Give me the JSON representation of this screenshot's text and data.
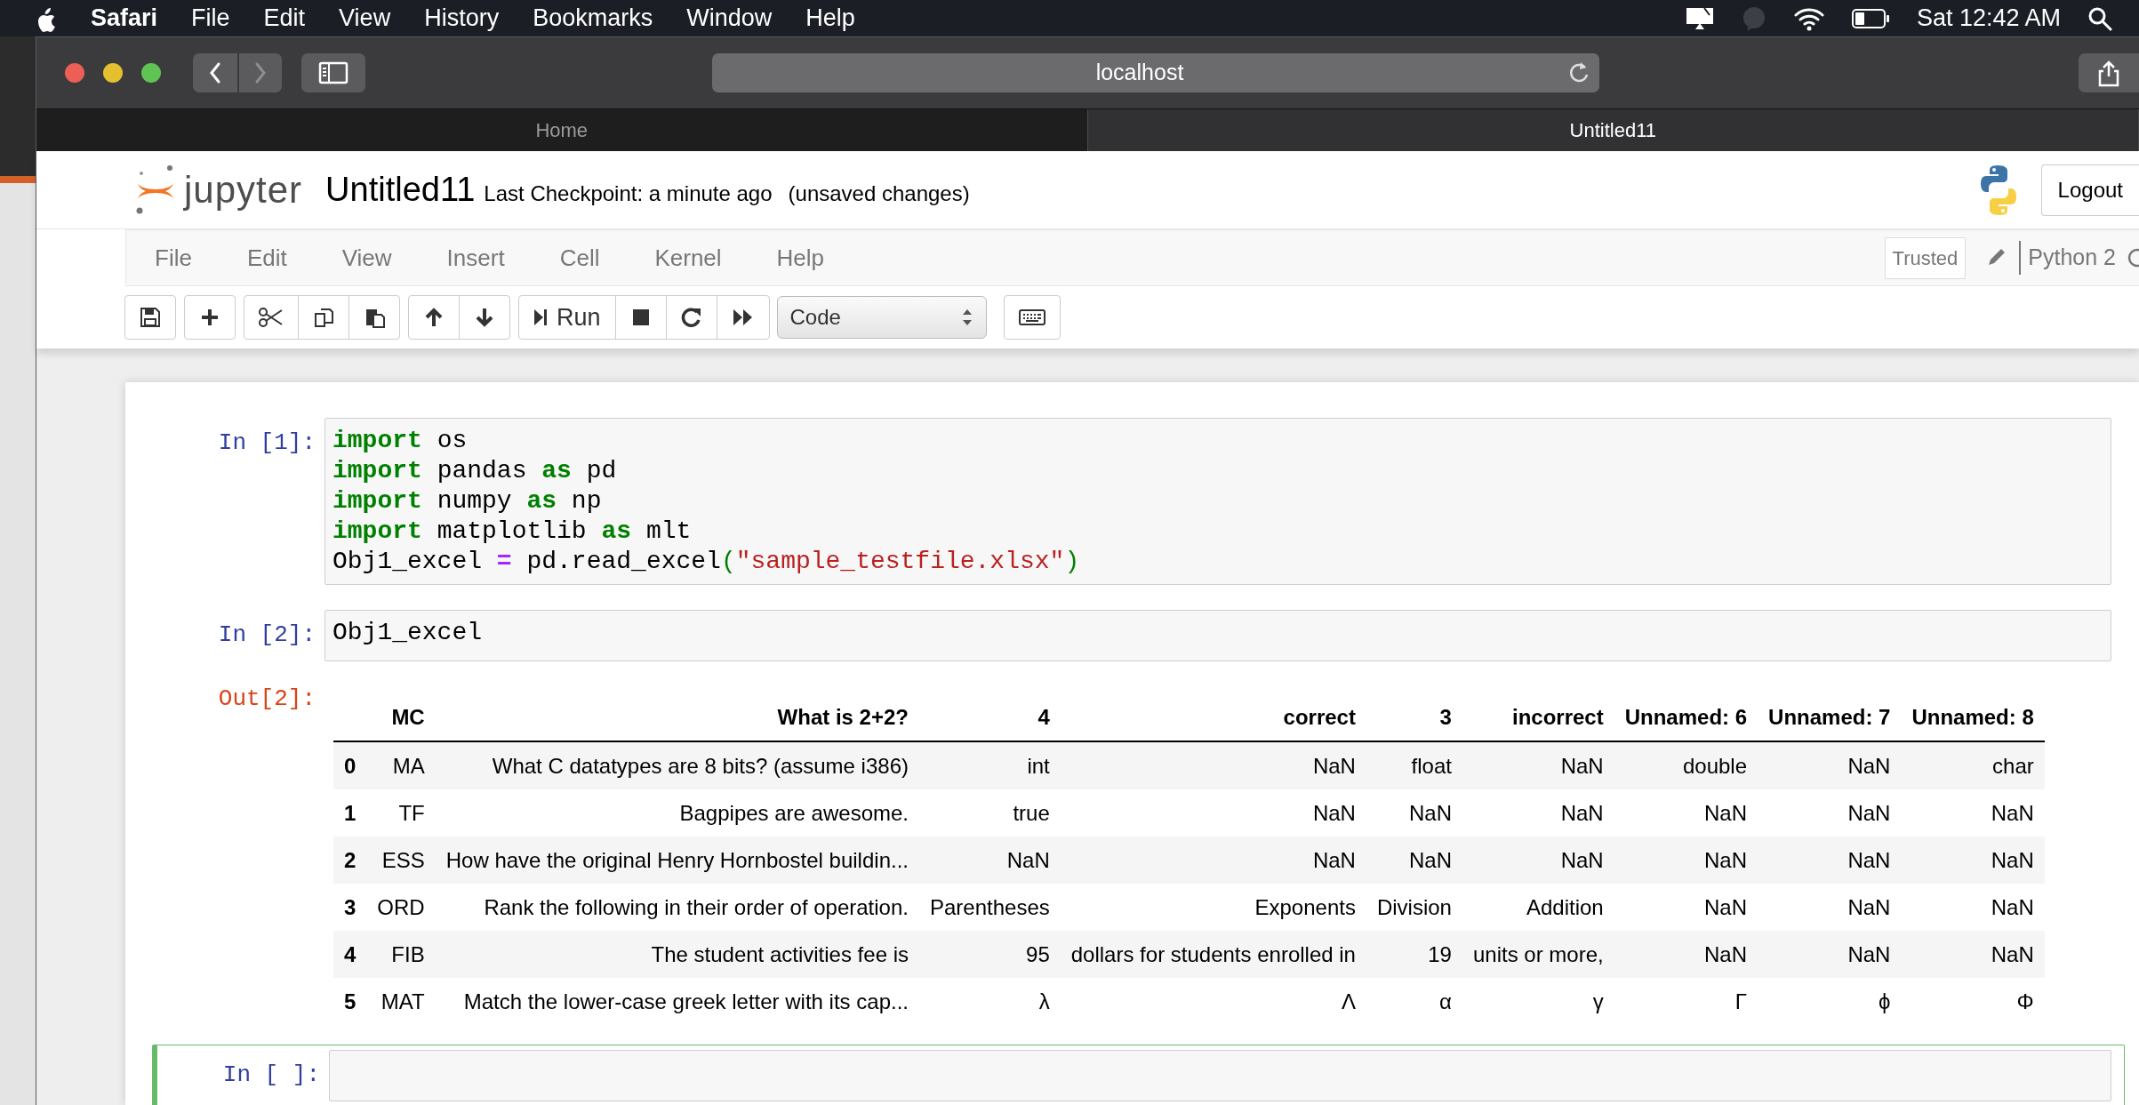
{
  "system_menu_bar": {
    "app": "Safari",
    "menus": [
      "File",
      "Edit",
      "View",
      "History",
      "Bookmarks",
      "Window",
      "Help"
    ],
    "clock": "Sat 12:42 AM"
  },
  "browser": {
    "address": "localhost",
    "tabs": [
      {
        "label": "Home",
        "selected": false
      },
      {
        "label": "Untitled11",
        "selected": true
      }
    ]
  },
  "notebook": {
    "logo_text": "jupyter",
    "title": "Untitled11",
    "checkpoint": "Last Checkpoint: a minute ago",
    "autosave": "(unsaved changes)",
    "logout": "Logout",
    "menus": [
      "File",
      "Edit",
      "View",
      "Insert",
      "Cell",
      "Kernel",
      "Help"
    ],
    "trusted": "Trusted",
    "kernel": "Python 2",
    "run_label": "Run",
    "cell_type": "Code"
  },
  "cells": [
    {
      "prompt": "In [1]:",
      "selected": false,
      "lines": [
        [
          {
            "kind": "kw",
            "s": "import"
          },
          {
            "kind": "plain",
            "s": " os"
          }
        ],
        [
          {
            "kind": "kw",
            "s": "import"
          },
          {
            "kind": "plain",
            "s": " pandas "
          },
          {
            "kind": "kw",
            "s": "as"
          },
          {
            "kind": "plain",
            "s": " pd"
          }
        ],
        [
          {
            "kind": "kw",
            "s": "import"
          },
          {
            "kind": "plain",
            "s": " numpy "
          },
          {
            "kind": "kw",
            "s": "as"
          },
          {
            "kind": "plain",
            "s": " np"
          }
        ],
        [
          {
            "kind": "kw",
            "s": "import"
          },
          {
            "kind": "plain",
            "s": " matplotlib "
          },
          {
            "kind": "kw",
            "s": "as"
          },
          {
            "kind": "plain",
            "s": " mlt"
          }
        ],
        [
          {
            "kind": "plain",
            "s": "Obj1_excel "
          },
          {
            "kind": "op",
            "s": "="
          },
          {
            "kind": "plain",
            "s": " pd.read_excel"
          },
          {
            "kind": "paren",
            "s": "("
          },
          {
            "kind": "str",
            "s": "\"sample_testfile.xlsx\""
          },
          {
            "kind": "paren",
            "s": ")"
          }
        ]
      ]
    },
    {
      "prompt": "In [2]:",
      "selected": false,
      "lines": [
        [
          {
            "kind": "plain",
            "s": "Obj1_excel"
          }
        ]
      ],
      "output": {
        "prompt": "Out[2]:",
        "table": {
          "columns": [
            "MC",
            "What is 2+2?",
            "4",
            "correct",
            "3",
            "incorrect",
            "Unnamed: 6",
            "Unnamed: 7",
            "Unnamed: 8"
          ],
          "rows": [
            {
              "index": "0",
              "cells": [
                "MA",
                "What C datatypes are 8 bits? (assume i386)",
                "int",
                "NaN",
                "float",
                "NaN",
                "double",
                "NaN",
                "char"
              ]
            },
            {
              "index": "1",
              "cells": [
                "TF",
                "Bagpipes are awesome.",
                "true",
                "NaN",
                "NaN",
                "NaN",
                "NaN",
                "NaN",
                "NaN"
              ]
            },
            {
              "index": "2",
              "cells": [
                "ESS",
                "How have the original Henry Hornbostel buildin...",
                "NaN",
                "NaN",
                "NaN",
                "NaN",
                "NaN",
                "NaN",
                "NaN"
              ]
            },
            {
              "index": "3",
              "cells": [
                "ORD",
                "Rank the following in their order of operation.",
                "Parentheses",
                "Exponents",
                "Division",
                "Addition",
                "NaN",
                "NaN",
                "NaN"
              ]
            },
            {
              "index": "4",
              "cells": [
                "FIB",
                "The student activities fee is",
                "95",
                "dollars for students enrolled in",
                "19",
                "units or more,",
                "NaN",
                "NaN",
                "NaN"
              ]
            },
            {
              "index": "5",
              "cells": [
                "MAT",
                "Match the lower-case greek letter with its cap...",
                "λ",
                "Λ",
                "α",
                "γ",
                "Γ",
                "ϕ",
                "Φ"
              ]
            }
          ]
        }
      }
    },
    {
      "prompt": "In [ ]:",
      "selected": true
    }
  ]
}
